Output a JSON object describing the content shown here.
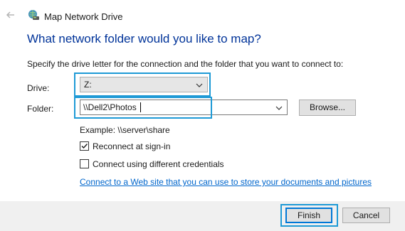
{
  "window": {
    "title": "Map Network Drive",
    "heading": "What network folder would you like to map?",
    "instruction": "Specify the drive letter for the connection and the folder that you want to connect to:"
  },
  "form": {
    "drive_label": "Drive:",
    "drive_value": "Z:",
    "folder_label": "Folder:",
    "folder_value": "\\\\Dell2\\Photos",
    "browse_label": "Browse...",
    "example": "Example: \\\\server\\share",
    "reconnect_label": "Reconnect at sign-in",
    "reconnect_checked": true,
    "different_credentials_label": "Connect using different credentials",
    "different_credentials_checked": false,
    "web_link": "Connect to a Web site that you can use to store your documents and pictures"
  },
  "footer": {
    "finish_label": "Finish",
    "cancel_label": "Cancel"
  },
  "colors": {
    "heading": "#003399",
    "link": "#0066cc",
    "highlight": "#1e9ad6",
    "footer_bg": "#f0f0f0"
  },
  "icons": {
    "back": "back-arrow-icon",
    "app": "network-drive-icon",
    "dropdown": "chevron-down-icon",
    "check": "checkmark-icon"
  }
}
